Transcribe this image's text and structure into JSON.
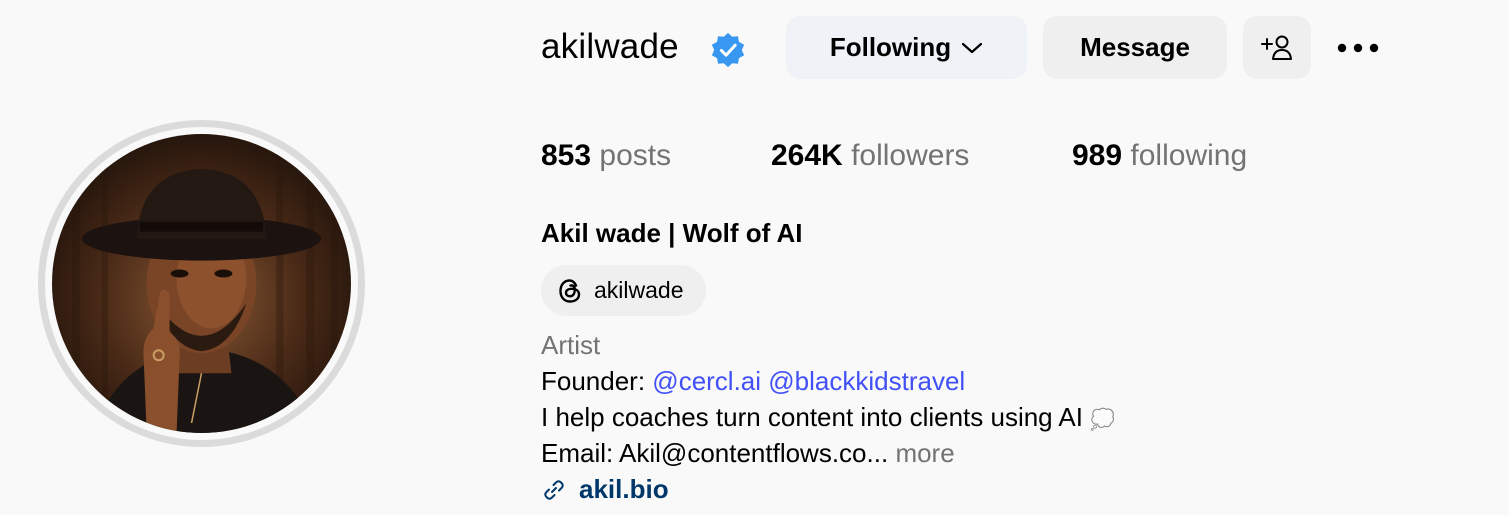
{
  "profile": {
    "username": "akilwade",
    "full_name": "Akil wade | Wolf of AI",
    "verified_icon": "verified-badge-icon"
  },
  "actions": {
    "following_label": "Following",
    "message_label": "Message",
    "add_user_icon": "add-user-icon",
    "more_icon": "more-options-icon"
  },
  "stats": [
    {
      "value": "853",
      "label": "posts"
    },
    {
      "value": "264K",
      "label": "followers"
    },
    {
      "value": "989",
      "label": "following"
    }
  ],
  "threads": {
    "icon": "threads-icon",
    "handle": "akilwade"
  },
  "bio": {
    "category": "Artist",
    "founder_prefix": "Founder: ",
    "mentions": [
      "@cercl.ai",
      "@blackkidstravel"
    ],
    "help_text": "I help coaches turn content into clients using AI",
    "help_emoji": "💭",
    "email_text": "Email: Akil@contentflows.co...",
    "more_label": "more"
  },
  "link": {
    "icon": "link-icon",
    "text": "akil.bio"
  },
  "colors": {
    "accent_verified": "#3897f0",
    "mention": "#4150f7",
    "link": "#00376b",
    "secondary_text": "#737373",
    "following_button_bg": "#eff2f7",
    "button_bg": "#efefef"
  }
}
